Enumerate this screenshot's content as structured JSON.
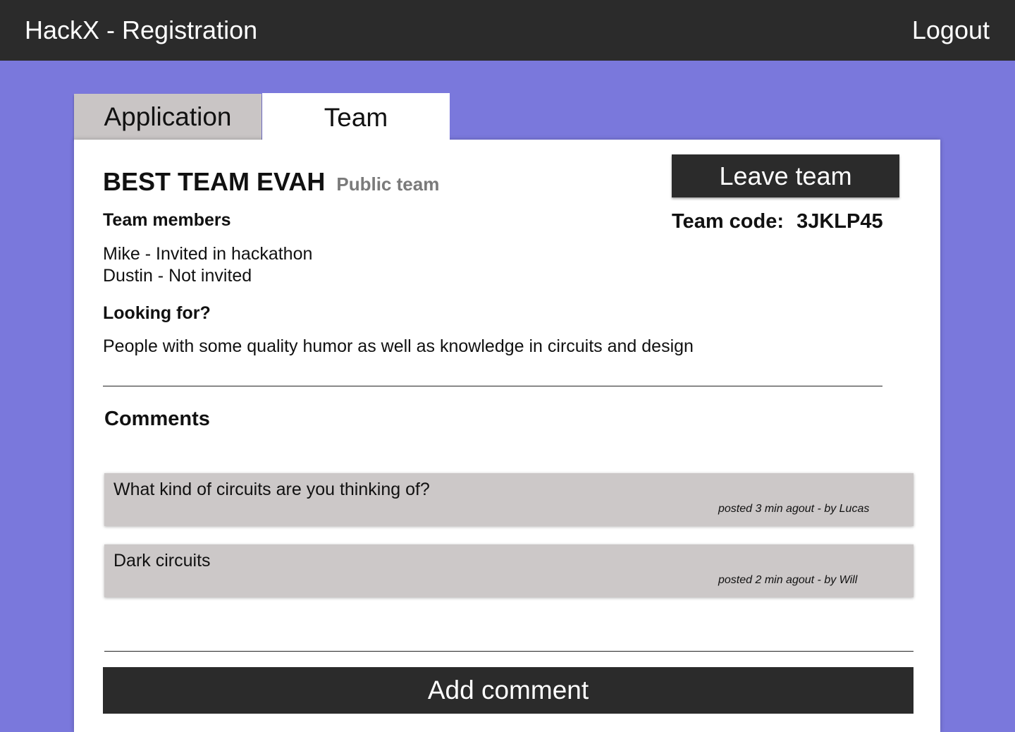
{
  "header": {
    "title": "HackX - Registration",
    "logout_label": "Logout"
  },
  "tabs": [
    {
      "label": "Application",
      "active": false
    },
    {
      "label": "Team",
      "active": true
    }
  ],
  "team": {
    "name": "BEST TEAM EVAH",
    "visibility": "Public team",
    "leave_label": "Leave team",
    "code_label": "Team code:",
    "code_value": "3JKLP45",
    "members_heading": "Team members",
    "members": [
      "Mike - Invited in hackathon",
      "Dustin -  Not invited"
    ],
    "looking_heading": "Looking for?",
    "looking_text": "People with some quality humor as well as knowledge in circuits and design"
  },
  "comments": {
    "heading": "Comments",
    "items": [
      {
        "text": "What kind of circuits are you thinking of?",
        "meta": "posted 3 min agout - by Lucas"
      },
      {
        "text": "Dark circuits",
        "meta": "posted 2 min agout - by Will"
      }
    ],
    "add_label": "Add comment"
  },
  "colors": {
    "background": "#7a78dc",
    "topbar": "#2b2b2b",
    "tab_inactive": "#c9c5c5",
    "comment_bg": "#ccc8c8",
    "button_dark": "#2b2b2b"
  }
}
